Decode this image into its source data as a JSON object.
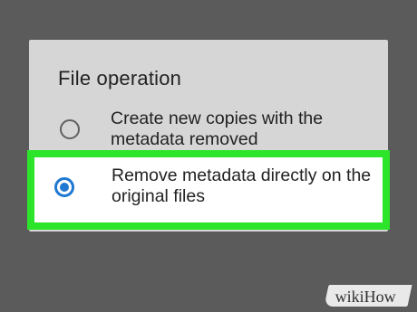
{
  "dialog": {
    "title": "File operation",
    "options": [
      {
        "label": "Create new copies with the metadata removed",
        "selected": false
      },
      {
        "label": "Remove metadata directly on the original files",
        "selected": true
      }
    ]
  },
  "watermark": {
    "text": "wikiHow"
  },
  "colors": {
    "backdrop": "#5b5b5b",
    "dialog": "#d6d6d6",
    "highlight": "#2ce52a",
    "radio_selected": "#1f78d1"
  }
}
